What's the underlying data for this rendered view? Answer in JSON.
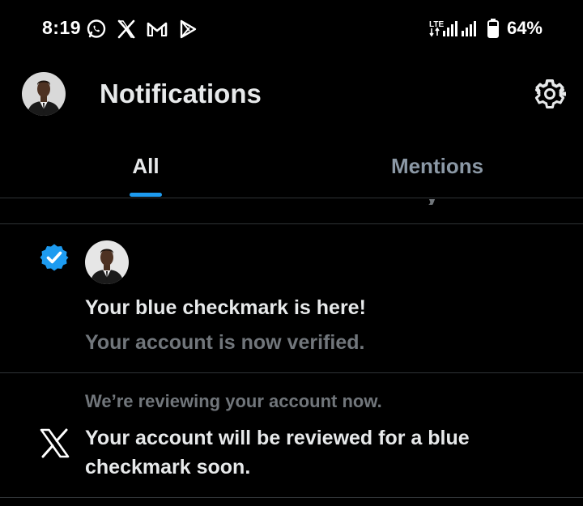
{
  "status_bar": {
    "time": "8:19",
    "notification_icons": [
      "whatsapp-icon",
      "x-icon",
      "gmail-icon",
      "play-store-icon"
    ],
    "network_label": "LTE",
    "battery": "64%"
  },
  "header": {
    "title": "Notifications",
    "avatar": "profile-avatar",
    "settings_icon": "gear-icon"
  },
  "tabs": [
    {
      "label": "All",
      "selected": true
    },
    {
      "label": "Mentions",
      "selected": false
    }
  ],
  "notifications": [
    {
      "icon": "verified-badge-icon",
      "title": "Your blue checkmark is here!",
      "subtitle": "Your account is now verified."
    },
    {
      "icon": "x-logo-icon",
      "caption": "We’re reviewing your account now.",
      "body": "Your account will be reviewed for a blue checkmark soon."
    }
  ],
  "colors": {
    "background": "#000000",
    "accent": "#1d9bf0",
    "text_primary": "#e7e9ea",
    "text_secondary": "#71767b",
    "divider": "#2f3336"
  }
}
